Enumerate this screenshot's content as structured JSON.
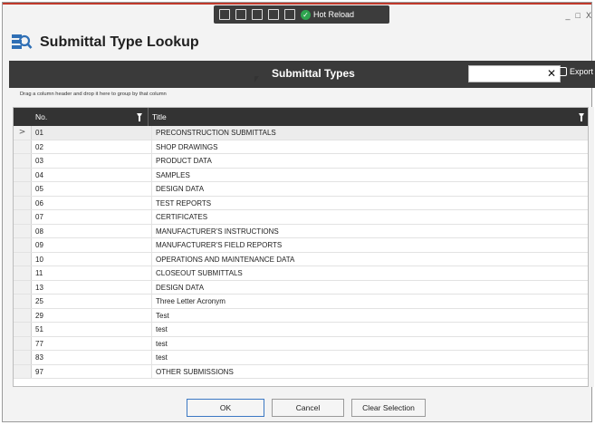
{
  "window": {
    "title": "Submittal Type Lookup",
    "controls": {
      "minimize": "_",
      "maximize": "□",
      "close": "X"
    }
  },
  "dev_toolbar": {
    "hot_reload_label": "Hot Reload"
  },
  "header": {
    "title": "Submittal Types",
    "search_value": "",
    "clear_glyph": "✕",
    "export_label": "Export"
  },
  "group_hint": "Drag a column header and drop it here to group by that column",
  "grid": {
    "columns": [
      "No.",
      "Title"
    ],
    "rows": [
      {
        "no": "01",
        "title": "PRECONSTRUCTION SUBMITTALS"
      },
      {
        "no": "02",
        "title": "SHOP DRAWINGS"
      },
      {
        "no": "03",
        "title": "PRODUCT DATA"
      },
      {
        "no": "04",
        "title": "SAMPLES"
      },
      {
        "no": "05",
        "title": "DESIGN DATA"
      },
      {
        "no": "06",
        "title": "TEST REPORTS"
      },
      {
        "no": "07",
        "title": "CERTIFICATES"
      },
      {
        "no": "08",
        "title": "MANUFACTURER'S INSTRUCTIONS"
      },
      {
        "no": "09",
        "title": "MANUFACTURER'S FIELD REPORTS"
      },
      {
        "no": "10",
        "title": "OPERATIONS AND MAINTENANCE DATA"
      },
      {
        "no": "11",
        "title": "CLOSEOUT SUBMITTALS"
      },
      {
        "no": "13",
        "title": "DESIGN DATA"
      },
      {
        "no": "25",
        "title": "Three Letter Acronym"
      },
      {
        "no": "29",
        "title": "Test"
      },
      {
        "no": "51",
        "title": "test"
      },
      {
        "no": "77",
        "title": "test"
      },
      {
        "no": "83",
        "title": "test"
      },
      {
        "no": "97",
        "title": "OTHER SUBMISSIONS"
      }
    ],
    "selected_indicator": ">"
  },
  "buttons": {
    "ok": "OK",
    "cancel": "Cancel",
    "clear_selection": "Clear Selection"
  },
  "colors": {
    "header_bg": "#3a3a3a",
    "grid_header_bg": "#333333",
    "accent_red": "#c0392b",
    "hot_reload_green": "#2ea44f",
    "primary_button_border": "#3b78c3"
  }
}
